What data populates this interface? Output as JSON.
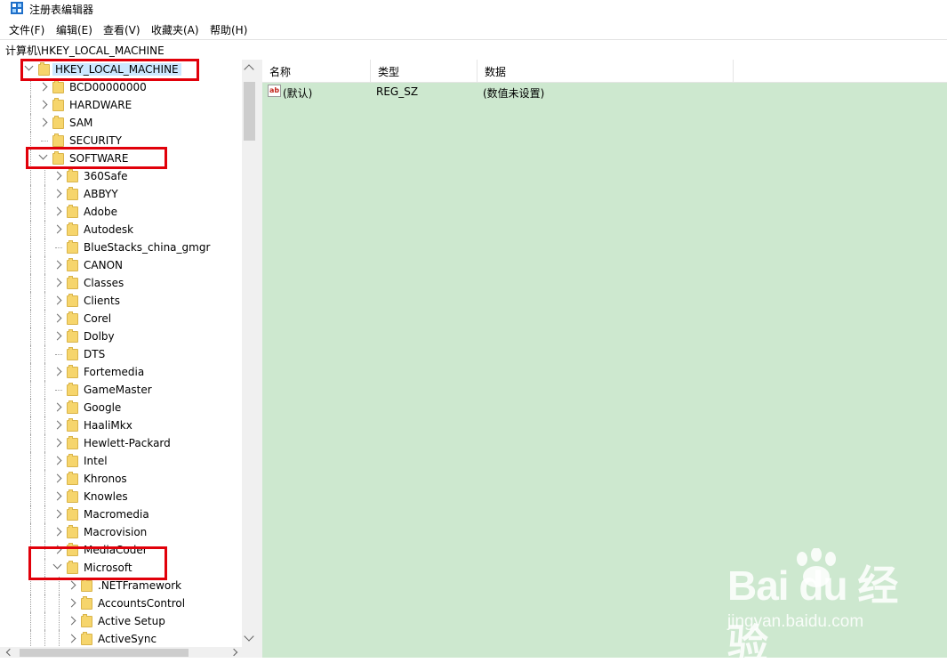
{
  "window": {
    "title": "注册表编辑器"
  },
  "menu": [
    "文件(F)",
    "编辑(E)",
    "查看(V)",
    "收藏夹(A)",
    "帮助(H)"
  ],
  "address": "计算机\\HKEY_LOCAL_MACHINE",
  "tree": {
    "root": "HKEY_LOCAL_MACHINE",
    "level1": [
      "BCD00000000",
      "HARDWARE",
      "SAM",
      "SECURITY",
      "SOFTWARE"
    ],
    "software_children": [
      "360Safe",
      "ABBYY",
      "Adobe",
      "Autodesk",
      "BlueStacks_china_gmgr",
      "CANON",
      "Classes",
      "Clients",
      "Corel",
      "Dolby",
      "DTS",
      "Fortemedia",
      "GameMaster",
      "Google",
      "HaaliMkx",
      "Hewlett-Packard",
      "Intel",
      "Khronos",
      "Knowles",
      "Macromedia",
      "Macrovision",
      "MediaCoder",
      "Microsoft"
    ],
    "microsoft_children": [
      ".NETFramework",
      "AccountsControl",
      "Active Setup",
      "ActiveSync"
    ]
  },
  "list": {
    "columns": [
      "名称",
      "类型",
      "数据"
    ],
    "rows": [
      {
        "name": "(默认)",
        "type": "REG_SZ",
        "data": "(数值未设置)"
      }
    ]
  },
  "colors": {
    "list_background": "#cde8cf",
    "highlight_box": "#e1000a",
    "selection": "#cce8ff"
  },
  "watermark": {
    "logo": "Bai du 经验",
    "sub": "jingyan.baidu.com"
  }
}
